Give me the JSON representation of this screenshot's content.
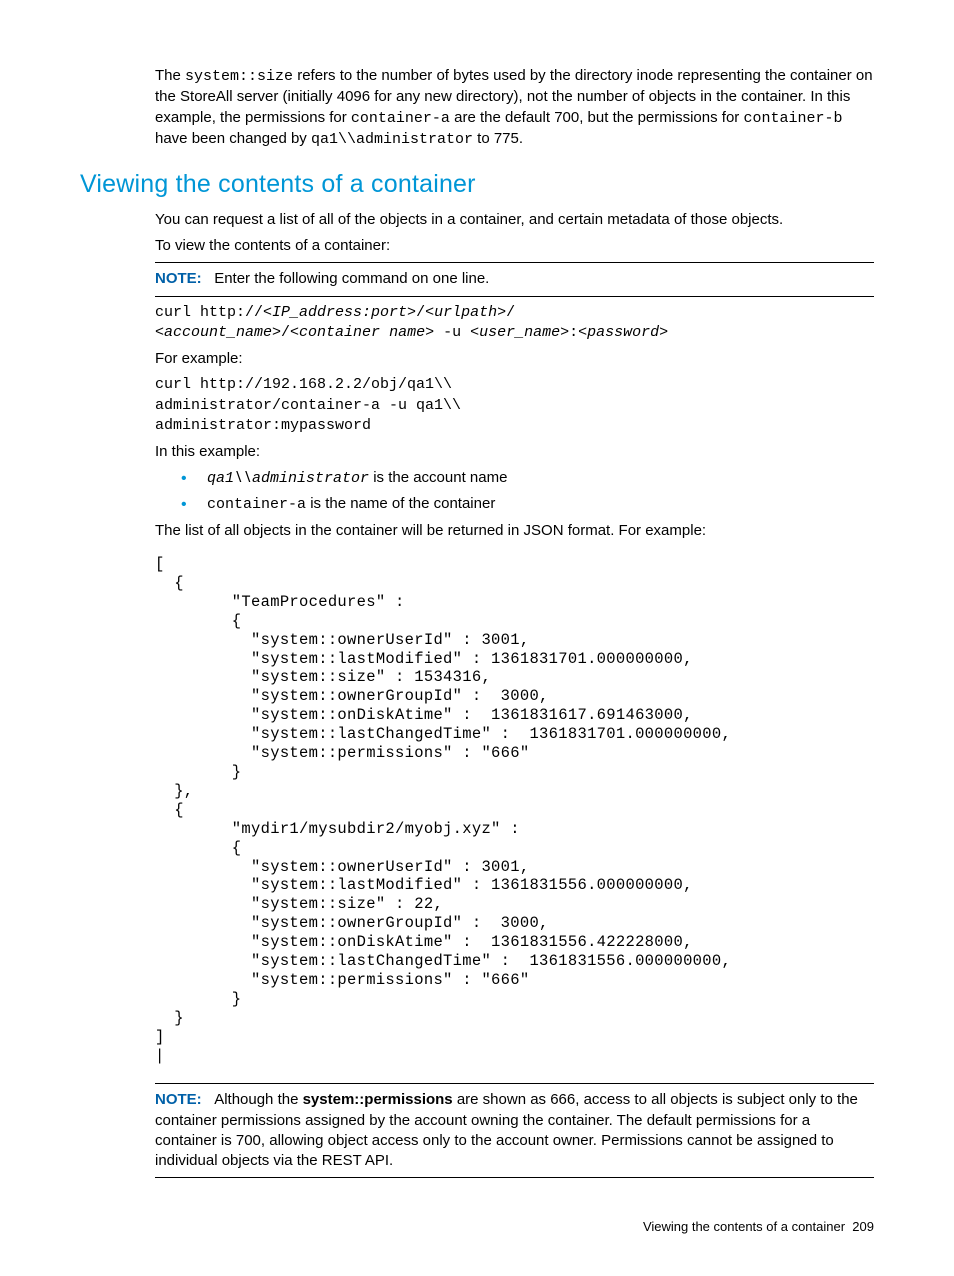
{
  "intro": {
    "t1a": "The ",
    "t1b": "system::size",
    "t1c": " refers to the number of bytes used by the directory inode representing the container on the StoreAll server (initially 4096 for any new directory), not the number of objects in the container. In this example, the permissions for ",
    "t1d": "container-a",
    "t1e": " are the default 700, but the permissions for ",
    "t1f": "container-b",
    "t1g": " have been changed by ",
    "t1h": "qa1\\\\administrator",
    "t1i": " to 775."
  },
  "heading": "Viewing the contents of a container",
  "p_request": "You can request a list of all of the objects in a container, and certain metadata of those objects.",
  "p_toview": "To view the contents of a container:",
  "note1": {
    "label": "NOTE:",
    "text": "Enter the following command on one line."
  },
  "cmd_template": {
    "prefix": "curl http://",
    "ip": "<IP_address:port>",
    "sep1": "/",
    "urlpath": "<urlpath>",
    "sep2": "/",
    "acct": "<account_name>",
    "sep3": "/",
    "cont": "<container name>",
    "flag": " -u ",
    "user": "<user_name>",
    "colon": ":",
    "pass": "<password>"
  },
  "for_example": "For example:",
  "cmd_example": "curl http://192.168.2.2/obj/qa1\\\\\nadministrator/container-a -u qa1\\\\\nadministrator:mypassword",
  "in_this_example": "In this example:",
  "bullets": {
    "b1a": "qa1\\\\administrator",
    "b1b": " is the account name",
    "b2a": "container-a",
    "b2b": " is the name of the container"
  },
  "p_list": "The list of all objects in the container will be returned in JSON format. For example:",
  "json_output": "[\n  {\n        \"TeamProcedures\" :\n        {\n          \"system::ownerUserId\" : 3001,\n          \"system::lastModified\" : 1361831701.000000000,\n          \"system::size\" : 1534316,\n          \"system::ownerGroupId\" :  3000,\n          \"system::onDiskAtime\" :  1361831617.691463000,\n          \"system::lastChangedTime\" :  1361831701.000000000,\n          \"system::permissions\" : \"666\"\n        }\n  },\n  {\n        \"mydir1/mysubdir2/myobj.xyz\" :\n        {\n          \"system::ownerUserId\" : 3001,\n          \"system::lastModified\" : 1361831556.000000000,\n          \"system::size\" : 22,\n          \"system::ownerGroupId\" :  3000,\n          \"system::onDiskAtime\" :  1361831556.422228000,\n          \"system::lastChangedTime\" :  1361831556.000000000,\n          \"system::permissions\" : \"666\"\n        }\n  }\n]\n|",
  "note2": {
    "label": "NOTE:",
    "t1": "Although the ",
    "t2": "system::permissions",
    "t3": " are shown as 666, access to all objects is subject only to the container permissions assigned by the account owning the container. The default permissions for a container is 700, allowing object access only to the account owner. Permissions cannot be assigned to individual objects via the REST API."
  },
  "footer": {
    "text": "Viewing the contents of a container",
    "page": "209"
  }
}
